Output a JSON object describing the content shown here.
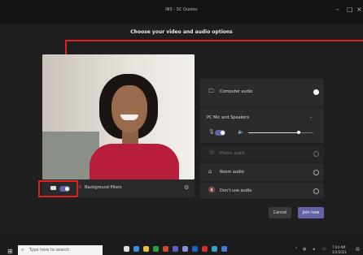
{
  "window": {
    "title": "INS - SC Quotes",
    "controls": [
      "–",
      "□",
      "×"
    ]
  },
  "dialog": {
    "heading": "Choose your video and audio options",
    "video": {
      "camera_toggle_on": true,
      "blur_label": "Background filters"
    },
    "audio": {
      "computer_audio_label": "Computer audio",
      "device_label": "PC Mic and Speakers",
      "device_toggle_on": true,
      "speaker_volume": 0.78,
      "phone_audio_label": "Phone audio",
      "room_audio_label": "Room audio",
      "no_audio_label": "Don't use audio"
    },
    "buttons": {
      "cancel": "Cancel",
      "join": "Join now"
    }
  },
  "taskbar": {
    "search_placeholder": "Type here to search",
    "start_icon": "windows-logo",
    "tray_time": "7:04 AM",
    "tray_date": "3/2/2021"
  },
  "colors": {
    "accent": "#6264a7",
    "highlight_box": "#e02020"
  }
}
